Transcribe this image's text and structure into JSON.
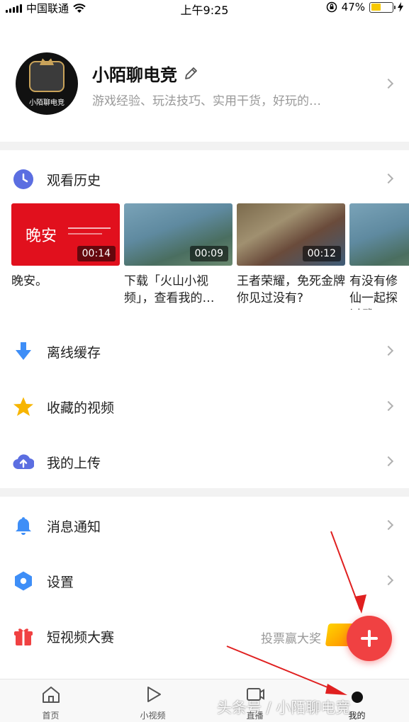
{
  "status_bar": {
    "carrier": "中国联通",
    "time": "上午9:25",
    "battery": "47%",
    "battery_level": 0.47
  },
  "profile": {
    "name": "小陌聊电竞",
    "description": "游戏经验、玩法技巧、实用干货，好玩的…",
    "avatar_text": "小陌聊电竞"
  },
  "history": {
    "label": "观看历史",
    "items": [
      {
        "title": "晚安。",
        "duration": "00:14",
        "thumb_text": "晚安"
      },
      {
        "title": "下载「火山小视频」，查看我的…",
        "duration": "00:09"
      },
      {
        "title": "王者荣耀，免死金牌你见过没有?",
        "duration": "00:12"
      },
      {
        "title": "有没有修仙一起探讨武",
        "duration": ""
      }
    ]
  },
  "menu_group1": [
    {
      "label": "离线缓存",
      "icon": "download-arrow-icon"
    },
    {
      "label": "收藏的视频",
      "icon": "star-icon"
    },
    {
      "label": "我的上传",
      "icon": "cloud-upload-icon"
    }
  ],
  "menu_group2": [
    {
      "label": "消息通知",
      "icon": "bell-icon"
    },
    {
      "label": "设置",
      "icon": "settings-hexagon-icon"
    },
    {
      "label": "短视频大赛",
      "icon": "gift-icon",
      "extra": "投票赢大奖"
    }
  ],
  "tabs": [
    {
      "label": "首页",
      "icon": "home-icon"
    },
    {
      "label": "小视频",
      "icon": "play-icon"
    },
    {
      "label": "直播",
      "icon": "live-icon"
    },
    {
      "label": "我的",
      "icon": "profile-dot-icon"
    }
  ],
  "watermark": "头条号 / 小陌聊电竞",
  "colors": {
    "accent": "#f04142",
    "history_icon": "#5b6ee1",
    "download_icon": "#3e8ef7",
    "star_icon": "#f7b500",
    "upload_icon": "#5b6ee1",
    "bell_icon": "#3e8ef7",
    "settings_icon": "#3e8ef7",
    "gift_icon": "#f04142"
  }
}
